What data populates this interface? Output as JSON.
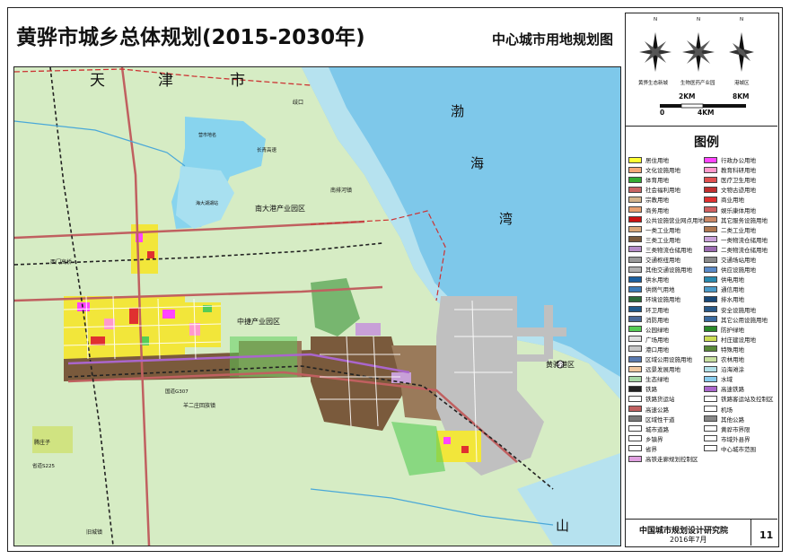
{
  "title": "黄骅市城乡总体规划(2015-2030年)",
  "subtitle": "中心城市用地规划图",
  "compass_labels": [
    "黄骅生态新城",
    "生物医药产业园",
    "港城区"
  ],
  "compass_n": "N",
  "scale": {
    "marks": [
      "0",
      "2KM",
      "4KM",
      "8KM"
    ]
  },
  "legend": {
    "title": "图例",
    "left": [
      {
        "label": "居住用地",
        "color": "#ffff33"
      },
      {
        "label": "文化设施用地",
        "color": "#f4a87a"
      },
      {
        "label": "体育用地",
        "color": "#33aa33"
      },
      {
        "label": "社会福利用地",
        "color": "#c86464"
      },
      {
        "label": "宗教用地",
        "color": "#d4b48c"
      },
      {
        "label": "商务用地",
        "color": "#e8a070"
      },
      {
        "label": "公共设施营业网点用地",
        "color": "#cc1111"
      },
      {
        "label": "一类工业用地",
        "color": "#d9a87a"
      },
      {
        "label": "三类工业用地",
        "color": "#7a5a3c"
      },
      {
        "label": "三类物流仓储用地",
        "color": "#b58cc8"
      },
      {
        "label": "交通枢纽用地",
        "color": "#9a9a9a"
      },
      {
        "label": "其他交通设施用地",
        "color": "#b0b0b0"
      },
      {
        "label": "供水用地",
        "color": "#1a5fa0"
      },
      {
        "label": "供燃气用地",
        "color": "#3a7ab8"
      },
      {
        "label": "环境设施用地",
        "color": "#2a6a3a"
      },
      {
        "label": "环卫用地",
        "color": "#1f5a8c"
      },
      {
        "label": "消防用地",
        "color": "#4a6a9a"
      },
      {
        "label": "公园绿地",
        "color": "#55cc55"
      },
      {
        "label": "广场用地",
        "color": "#e0e0e0"
      },
      {
        "label": "港口用地",
        "color": "#c8c8c8"
      },
      {
        "label": "区域公用设施用地",
        "color": "#5a7ab0"
      },
      {
        "label": "远景发展用地",
        "color": "#f0c8a0"
      },
      {
        "label": "生态绿地",
        "color": "#a8d8a8"
      },
      {
        "label": "铁路",
        "color": "#222222"
      },
      {
        "label": "铁路货运站",
        "color": "#ffffff"
      },
      {
        "label": "高速公路",
        "color": "#c06060"
      },
      {
        "label": "区域性干道",
        "color": "#7a7a7a"
      },
      {
        "label": "城市道路",
        "color": "#ffffff"
      },
      {
        "label": "乡镇界",
        "color": "#ffffff"
      },
      {
        "label": "省界",
        "color": "#ffffff"
      },
      {
        "label": "高铁走廊规划控制区",
        "color": "#e0a0e0"
      }
    ],
    "right": [
      {
        "label": "行政办公用地",
        "color": "#ff44ff"
      },
      {
        "label": "教育科研用地",
        "color": "#ff99cc"
      },
      {
        "label": "医疗卫生用地",
        "color": "#e05050"
      },
      {
        "label": "文物古迹用地",
        "color": "#c03030"
      },
      {
        "label": "商业用地",
        "color": "#e03030"
      },
      {
        "label": "娱乐康体用地",
        "color": "#d06060"
      },
      {
        "label": "其它服务设施用地",
        "color": "#cc8866"
      },
      {
        "label": "二类工业用地",
        "color": "#b07850"
      },
      {
        "label": "一类物流仓储用地",
        "color": "#c8a0d8"
      },
      {
        "label": "二类物流仓储用地",
        "color": "#9a6ab0"
      },
      {
        "label": "交通场站用地",
        "color": "#8a8a8a"
      },
      {
        "label": "供应设施用地",
        "color": "#5a8ac8"
      },
      {
        "label": "供电用地",
        "color": "#2a8ab0"
      },
      {
        "label": "通信用地",
        "color": "#4a9ac8"
      },
      {
        "label": "排水用地",
        "color": "#1a4a7a"
      },
      {
        "label": "安全设施用地",
        "color": "#2a5a8a"
      },
      {
        "label": "其它公用设施用地",
        "color": "#3a6aa0"
      },
      {
        "label": "防护绿地",
        "color": "#2a8a2a"
      },
      {
        "label": "村庄建设用地",
        "color": "#ccdd55"
      },
      {
        "label": "特殊用地",
        "color": "#5a8a3a"
      },
      {
        "label": "农林用地",
        "color": "#c8e0a0"
      },
      {
        "label": "沿海滩涂",
        "color": "#b0e0e8"
      },
      {
        "label": "水域",
        "color": "#88ccee"
      },
      {
        "label": "高速铁路",
        "color": "#aa66cc"
      },
      {
        "label": "铁路客运站及控制区",
        "color": "#ffffff"
      },
      {
        "label": "机场",
        "color": "#ffffff"
      },
      {
        "label": "其他公路",
        "color": "#888888"
      },
      {
        "label": "黄骅市界限",
        "color": "#ffffff"
      },
      {
        "label": "市域外县界",
        "color": "#ffffff"
      },
      {
        "label": "中心城市范围",
        "color": "#ffffff"
      }
    ]
  },
  "map_labels": {
    "tianjin": "天",
    "tianjin2": "津",
    "tianjin3": "市",
    "bo": "渤",
    "hai": "海",
    "wan": "湾",
    "shan": "山",
    "nandagang": "南大港产业园区",
    "zhongjie": "中捷产业园区",
    "huanghuagang": "黄骅港区",
    "qikou": "歧口",
    "nanpaihe": "南排河镇",
    "hupo": "海大湖湖站",
    "guanzhaohu": "营市地名",
    "huanghualu": "西门高桥",
    "yangerzhuang": "羊二庄回族镇",
    "jiuzhuang": "旧城镇",
    "tengzhuang": "腾庄子",
    "guodao": "国道G307",
    "shengdao": "省道S225",
    "changqing": "长青高速"
  },
  "footer": {
    "org": "中国城市规划设计研究院",
    "date": "2016年7月",
    "page": "11"
  }
}
